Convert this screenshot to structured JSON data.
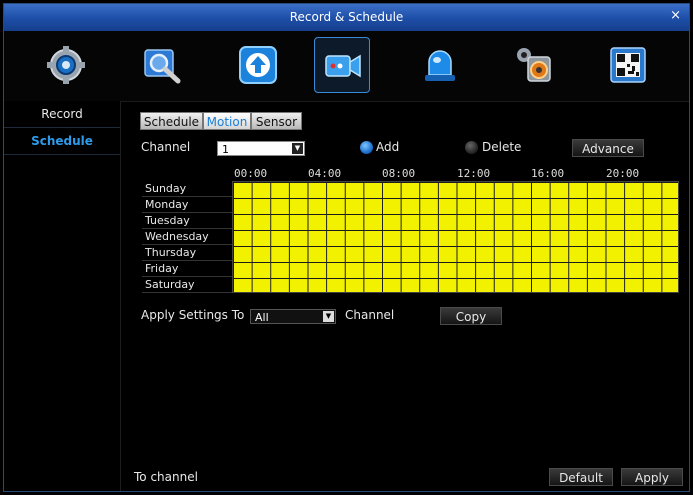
{
  "window": {
    "title": "Record & Schedule",
    "close": "×"
  },
  "toolbar_icons": [
    {
      "name": "system-gear-icon"
    },
    {
      "name": "search-icon"
    },
    {
      "name": "upgrade-arrow-icon"
    },
    {
      "name": "camera-record-icon"
    },
    {
      "name": "alarm-siren-icon"
    },
    {
      "name": "settings-disk-icon"
    },
    {
      "name": "qr-code-icon"
    }
  ],
  "sidebar": {
    "items": [
      {
        "label": "Record"
      },
      {
        "label": "Schedule"
      }
    ],
    "active": "Schedule"
  },
  "tabs": [
    {
      "label": "Schedule"
    },
    {
      "label": "Motion"
    },
    {
      "label": "Sensor"
    }
  ],
  "active_tab": "Motion",
  "channel": {
    "label": "Channel",
    "value": "1"
  },
  "mode": {
    "add_label": "Add",
    "delete_label": "Delete",
    "selected": "Add"
  },
  "advance_label": "Advance",
  "schedule": {
    "hour_labels": [
      "00:00",
      "04:00",
      "08:00",
      "12:00",
      "16:00",
      "20:00"
    ],
    "days": [
      "Sunday",
      "Monday",
      "Tuesday",
      "Wednesday",
      "Thursday",
      "Friday",
      "Saturday"
    ],
    "fill_color": "#f2f200",
    "all_selected": true
  },
  "apply": {
    "label": "Apply Settings To",
    "value": "All",
    "channel_label": "Channel",
    "copy_label": "Copy"
  },
  "footer": {
    "to_channel_label": "To channel",
    "default_label": "Default",
    "apply_label": "Apply"
  },
  "colors": {
    "accent": "#2e9bea",
    "title_bar": "#1d4ea7"
  }
}
